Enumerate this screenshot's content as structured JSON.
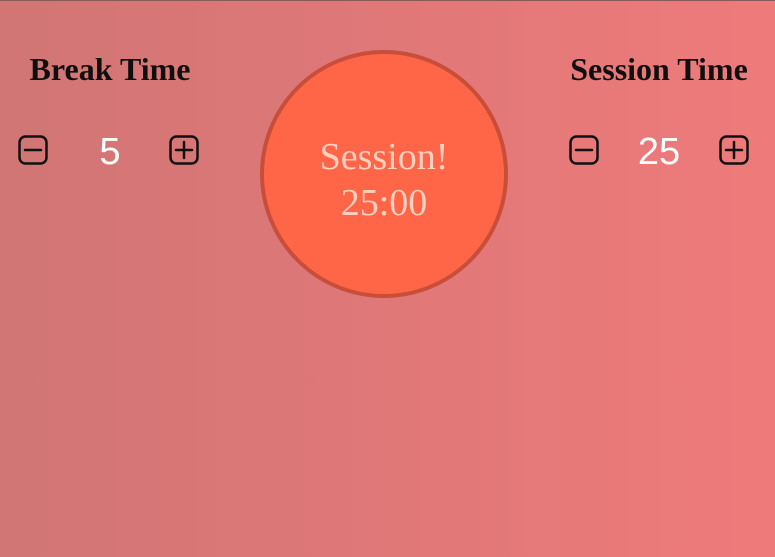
{
  "break": {
    "title": "Break Time",
    "value": "5",
    "decrement_icon": "minus-square-icon",
    "increment_icon": "plus-square-icon"
  },
  "session": {
    "title": "Session Time",
    "value": "25",
    "decrement_icon": "minus-square-icon",
    "increment_icon": "plus-square-icon"
  },
  "timer": {
    "label": "Session!",
    "time": "25:00"
  },
  "colors": {
    "background_start": "#d17575",
    "background_end": "#ef7a7a",
    "timer_fill": "#ff6647",
    "timer_border": "#c84e3a",
    "timer_text": "#ffcfbf",
    "value_text": "#ffffff"
  }
}
